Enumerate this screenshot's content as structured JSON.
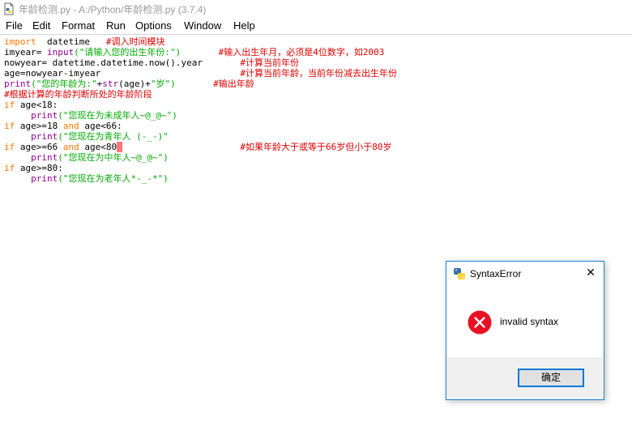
{
  "window": {
    "title": "年龄检测.py - A:/Python/年龄检测.py (3.7.4)",
    "icon": "python-file-icon"
  },
  "menu": [
    "File",
    "Edit",
    "Format",
    "Run",
    "Options",
    "Window",
    "Help"
  ],
  "code_lines": [
    [
      [
        "kw",
        "import"
      ],
      [
        "",
        "  datetime   "
      ],
      [
        "cm",
        "#调入时间模块"
      ]
    ],
    [
      [
        "",
        "imyear= "
      ],
      [
        "bi",
        "input"
      ],
      [
        "str",
        "(\"请输入您的出生年份:\")"
      ],
      [
        "",
        "       "
      ],
      [
        "cm",
        "#输入出生年月，必须是4位数字，如2003"
      ]
    ],
    [
      [
        "",
        "nowyear= datetime.datetime.now().year       "
      ],
      [
        "cm",
        "#计算当前年份"
      ]
    ],
    [
      [
        "",
        "age=nowyear-imyear                          "
      ],
      [
        "cm",
        "#计算当前年龄，当前年份减去出生年份"
      ]
    ],
    [
      [
        "bi",
        "print"
      ],
      [
        "str",
        "(\"您的年龄为:\""
      ],
      [
        "",
        "+"
      ],
      [
        "bi",
        "str"
      ],
      [
        "",
        "(age)+"
      ],
      [
        "str",
        "\"岁\")"
      ],
      [
        "",
        "       "
      ],
      [
        "cm",
        "#输出年龄"
      ]
    ],
    [
      [
        "cm",
        "#根据计算的年龄判断所处的年龄阶段"
      ]
    ],
    [
      [
        "kw",
        "if"
      ],
      [
        "",
        " age<18:"
      ]
    ],
    [
      [
        "",
        "     "
      ],
      [
        "bi",
        "print"
      ],
      [
        "str",
        "(\"您现在为未成年人~@_@~\")"
      ]
    ],
    [
      [
        "kw",
        "if"
      ],
      [
        "",
        " age>=18 "
      ],
      [
        "kw",
        "and"
      ],
      [
        "",
        " age<66:"
      ]
    ],
    [
      [
        "",
        "     "
      ],
      [
        "bi",
        "print"
      ],
      [
        "str",
        "(\"您现在为青年人 (-_-)\""
      ]
    ],
    [
      [
        "kw",
        "if"
      ],
      [
        "",
        " age>=66 "
      ],
      [
        "kw",
        "and"
      ],
      [
        "",
        " age<80"
      ],
      [
        "err",
        " "
      ],
      [
        "",
        "                      "
      ],
      [
        "cm",
        "#如果年龄大于或等于66岁但小于80岁"
      ]
    ],
    [
      [
        "",
        "     "
      ],
      [
        "bi",
        "print"
      ],
      [
        "str",
        "(\"您现在为中年人~@_@~\")"
      ]
    ],
    [
      [
        "kw",
        "if"
      ],
      [
        "",
        " age>=80:"
      ]
    ],
    [
      [
        "",
        "     "
      ],
      [
        "bi",
        "print"
      ],
      [
        "str",
        "(\"您现在为老年人*-_-*\")"
      ]
    ]
  ],
  "dialog": {
    "title": "SyntaxError",
    "title_icon": "python-icon",
    "close_icon": "close-icon",
    "error_icon": "error-x-icon",
    "message": "invalid syntax",
    "ok_label": "确定"
  },
  "colors": {
    "keyword": "#ff7700",
    "builtin": "#900090",
    "string": "#00aa00",
    "comment": "#dd0000",
    "error_highlight": "#ff7777",
    "dialog_border": "#1883d7",
    "error_icon": "#e81123"
  }
}
